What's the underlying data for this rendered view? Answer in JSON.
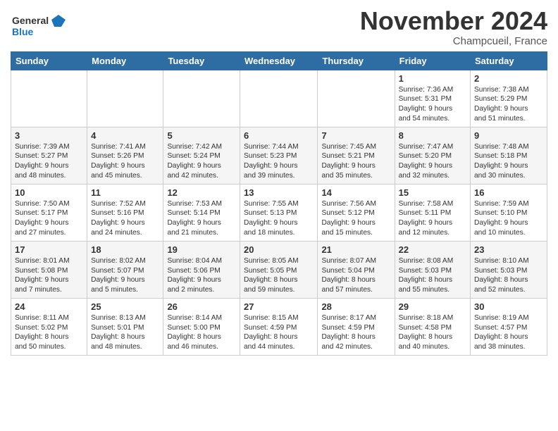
{
  "header": {
    "logo_line1": "General",
    "logo_line2": "Blue",
    "month": "November 2024",
    "location": "Champcueil, France"
  },
  "weekdays": [
    "Sunday",
    "Monday",
    "Tuesday",
    "Wednesday",
    "Thursday",
    "Friday",
    "Saturday"
  ],
  "weeks": [
    [
      {
        "day": "",
        "info": ""
      },
      {
        "day": "",
        "info": ""
      },
      {
        "day": "",
        "info": ""
      },
      {
        "day": "",
        "info": ""
      },
      {
        "day": "",
        "info": ""
      },
      {
        "day": "1",
        "info": "Sunrise: 7:36 AM\nSunset: 5:31 PM\nDaylight: 9 hours\nand 54 minutes."
      },
      {
        "day": "2",
        "info": "Sunrise: 7:38 AM\nSunset: 5:29 PM\nDaylight: 9 hours\nand 51 minutes."
      }
    ],
    [
      {
        "day": "3",
        "info": "Sunrise: 7:39 AM\nSunset: 5:27 PM\nDaylight: 9 hours\nand 48 minutes."
      },
      {
        "day": "4",
        "info": "Sunrise: 7:41 AM\nSunset: 5:26 PM\nDaylight: 9 hours\nand 45 minutes."
      },
      {
        "day": "5",
        "info": "Sunrise: 7:42 AM\nSunset: 5:24 PM\nDaylight: 9 hours\nand 42 minutes."
      },
      {
        "day": "6",
        "info": "Sunrise: 7:44 AM\nSunset: 5:23 PM\nDaylight: 9 hours\nand 39 minutes."
      },
      {
        "day": "7",
        "info": "Sunrise: 7:45 AM\nSunset: 5:21 PM\nDaylight: 9 hours\nand 35 minutes."
      },
      {
        "day": "8",
        "info": "Sunrise: 7:47 AM\nSunset: 5:20 PM\nDaylight: 9 hours\nand 32 minutes."
      },
      {
        "day": "9",
        "info": "Sunrise: 7:48 AM\nSunset: 5:18 PM\nDaylight: 9 hours\nand 30 minutes."
      }
    ],
    [
      {
        "day": "10",
        "info": "Sunrise: 7:50 AM\nSunset: 5:17 PM\nDaylight: 9 hours\nand 27 minutes."
      },
      {
        "day": "11",
        "info": "Sunrise: 7:52 AM\nSunset: 5:16 PM\nDaylight: 9 hours\nand 24 minutes."
      },
      {
        "day": "12",
        "info": "Sunrise: 7:53 AM\nSunset: 5:14 PM\nDaylight: 9 hours\nand 21 minutes."
      },
      {
        "day": "13",
        "info": "Sunrise: 7:55 AM\nSunset: 5:13 PM\nDaylight: 9 hours\nand 18 minutes."
      },
      {
        "day": "14",
        "info": "Sunrise: 7:56 AM\nSunset: 5:12 PM\nDaylight: 9 hours\nand 15 minutes."
      },
      {
        "day": "15",
        "info": "Sunrise: 7:58 AM\nSunset: 5:11 PM\nDaylight: 9 hours\nand 12 minutes."
      },
      {
        "day": "16",
        "info": "Sunrise: 7:59 AM\nSunset: 5:10 PM\nDaylight: 9 hours\nand 10 minutes."
      }
    ],
    [
      {
        "day": "17",
        "info": "Sunrise: 8:01 AM\nSunset: 5:08 PM\nDaylight: 9 hours\nand 7 minutes."
      },
      {
        "day": "18",
        "info": "Sunrise: 8:02 AM\nSunset: 5:07 PM\nDaylight: 9 hours\nand 5 minutes."
      },
      {
        "day": "19",
        "info": "Sunrise: 8:04 AM\nSunset: 5:06 PM\nDaylight: 9 hours\nand 2 minutes."
      },
      {
        "day": "20",
        "info": "Sunrise: 8:05 AM\nSunset: 5:05 PM\nDaylight: 8 hours\nand 59 minutes."
      },
      {
        "day": "21",
        "info": "Sunrise: 8:07 AM\nSunset: 5:04 PM\nDaylight: 8 hours\nand 57 minutes."
      },
      {
        "day": "22",
        "info": "Sunrise: 8:08 AM\nSunset: 5:03 PM\nDaylight: 8 hours\nand 55 minutes."
      },
      {
        "day": "23",
        "info": "Sunrise: 8:10 AM\nSunset: 5:03 PM\nDaylight: 8 hours\nand 52 minutes."
      }
    ],
    [
      {
        "day": "24",
        "info": "Sunrise: 8:11 AM\nSunset: 5:02 PM\nDaylight: 8 hours\nand 50 minutes."
      },
      {
        "day": "25",
        "info": "Sunrise: 8:13 AM\nSunset: 5:01 PM\nDaylight: 8 hours\nand 48 minutes."
      },
      {
        "day": "26",
        "info": "Sunrise: 8:14 AM\nSunset: 5:00 PM\nDaylight: 8 hours\nand 46 minutes."
      },
      {
        "day": "27",
        "info": "Sunrise: 8:15 AM\nSunset: 4:59 PM\nDaylight: 8 hours\nand 44 minutes."
      },
      {
        "day": "28",
        "info": "Sunrise: 8:17 AM\nSunset: 4:59 PM\nDaylight: 8 hours\nand 42 minutes."
      },
      {
        "day": "29",
        "info": "Sunrise: 8:18 AM\nSunset: 4:58 PM\nDaylight: 8 hours\nand 40 minutes."
      },
      {
        "day": "30",
        "info": "Sunrise: 8:19 AM\nSunset: 4:57 PM\nDaylight: 8 hours\nand 38 minutes."
      }
    ]
  ]
}
